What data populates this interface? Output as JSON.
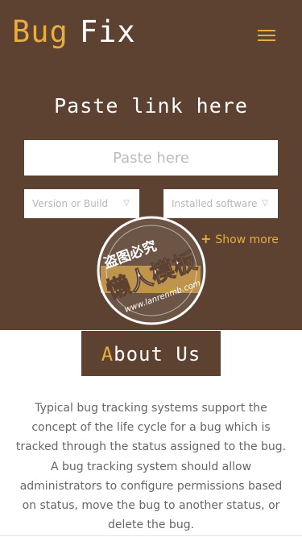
{
  "header": {
    "logo_word1": "Bug",
    "logo_word2": "Fix",
    "menu_icon": "hamburger-icon"
  },
  "form": {
    "title": "Paste link here",
    "paste_placeholder": "Paste here",
    "version_select": "Version or Build",
    "software_select": "Installed software",
    "select_arrow": "▽",
    "show_more_icon": "plus-icon",
    "show_more_plus": "+",
    "show_more_label": "Show more"
  },
  "watermark": {
    "line1": "盗图必究",
    "line2": "懒人模板",
    "url": "www.lanrenmb.com"
  },
  "about": {
    "title_first": "A",
    "title_rest": "bout Us",
    "text": "Typical bug tracking systems support the concept of the life cycle for a bug which is tracked through the status assigned to the bug. A bug tracking system should allow administrators to configure permissions based on status, move the bug to another status, or delete the bug."
  },
  "colors": {
    "hero_bg": "#5d4232",
    "accent": "#e8ad40",
    "button": "#b88a3a",
    "body_text": "#666666"
  }
}
